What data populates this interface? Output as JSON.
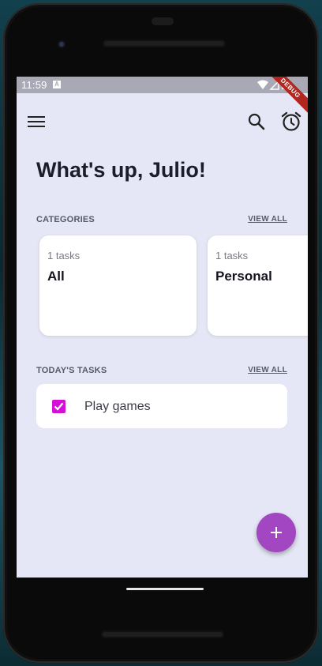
{
  "status_bar": {
    "time": "11:59",
    "notification_icon": "A",
    "debug_banner": "DEBUG"
  },
  "app_bar": {
    "menu_icon": "hamburger-menu-icon",
    "search_icon": "search-icon",
    "alarm_icon": "alarm-clock-icon"
  },
  "greeting": "What's up, Julio!",
  "categories": {
    "label": "CATEGORIES",
    "view_all": "VIEW ALL",
    "items": [
      {
        "count_text": "1 tasks",
        "name": "All"
      },
      {
        "count_text": "1 tasks",
        "name": "Personal"
      }
    ]
  },
  "todays_tasks": {
    "label": "TODAY'S TASKS",
    "view_all": "VIEW ALL",
    "items": [
      {
        "title": "Play games",
        "done": true
      }
    ]
  },
  "fab": {
    "icon": "plus-icon"
  },
  "colors": {
    "background": "#e6e7f6",
    "checkbox": "#d60fd6",
    "fab": "#a246c2",
    "debug_banner": "#b3261e"
  }
}
